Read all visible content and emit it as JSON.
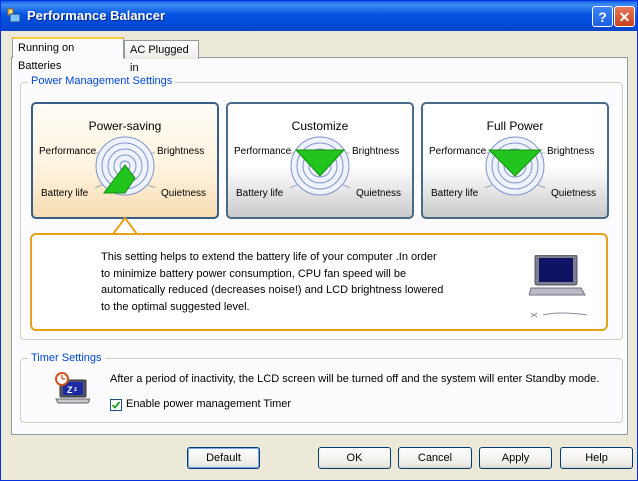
{
  "window": {
    "title": "Performance Balancer",
    "help_label": "?",
    "close_label": "✕"
  },
  "tabs": [
    {
      "label": "Running on Batteries",
      "active": true
    },
    {
      "label": "AC Plugged in",
      "active": false
    }
  ],
  "power_management": {
    "group_label": "Power Management Settings",
    "modes": [
      {
        "title": "Power-saving",
        "selected": true,
        "labels": {
          "performance": "Performance",
          "brightness": "Brightness",
          "battery_life": "Battery life",
          "quietness": "Quietness"
        }
      },
      {
        "title": "Customize",
        "selected": false,
        "labels": {
          "performance": "Performance",
          "brightness": "Brightness",
          "battery_life": "Battery life",
          "quietness": "Quietness"
        }
      },
      {
        "title": "Full Power",
        "selected": false,
        "labels": {
          "performance": "Performance",
          "brightness": "Brightness",
          "battery_life": "Battery life",
          "quietness": "Quietness"
        }
      }
    ],
    "description_lines": [
      "This setting helps to extend the battery life of your computer .In order",
      "to minimize battery power consumption, CPU fan speed will be",
      "automatically reduced (decreases noise!) and LCD brightness lowered",
      "to the optimal suggested level."
    ]
  },
  "timer": {
    "group_label": "Timer Settings",
    "message": "After a period of inactivity, the LCD screen will be turned off and the system will enter Standby mode.",
    "checkbox_label": "Enable power management Timer",
    "checkbox_checked": true
  },
  "buttons": {
    "default": "Default",
    "ok": "OK",
    "cancel": "Cancel",
    "apply": "Apply",
    "help": "Help"
  },
  "colors": {
    "accent_green": "#22c41e",
    "selection_orange": "#e3a21a",
    "group_label_blue": "#0046d5"
  }
}
